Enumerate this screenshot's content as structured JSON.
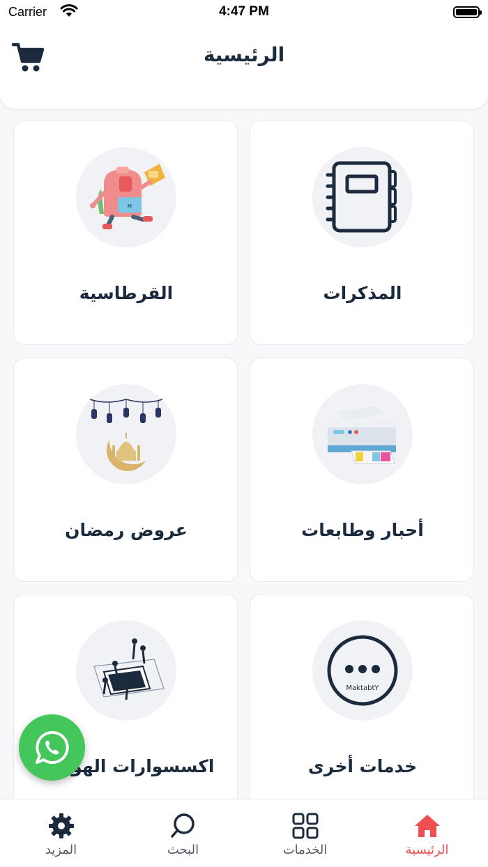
{
  "status_bar": {
    "carrier": "Carrier",
    "time": "4:47 PM"
  },
  "header": {
    "title": "الرئيسية",
    "cart_icon": "shopping-cart-icon"
  },
  "categories": [
    {
      "label": "المذكرات",
      "icon": "notebook-icon"
    },
    {
      "label": "القرطاسية",
      "icon": "school-backpack-illustration"
    },
    {
      "label": "أحبار وطابعات",
      "icon": "printer-illustration"
    },
    {
      "label": "عروض رمضان",
      "icon": "ramadan-lanterns-illustration"
    },
    {
      "label": "خدمات أخرى",
      "icon": "more-dots-icon"
    },
    {
      "label": "اكسسوارات الهواتف",
      "icon": "phone-accessories-illustration"
    }
  ],
  "other_services_logo": "MaktabtY",
  "whatsapp": {
    "icon": "whatsapp-icon",
    "color": "#45c65a"
  },
  "bottom_nav": [
    {
      "label": "الرئيسية",
      "icon": "home-icon",
      "active": true
    },
    {
      "label": "الخدمات",
      "icon": "grid-icon",
      "active": false
    },
    {
      "label": "البحث",
      "icon": "search-icon",
      "active": false
    },
    {
      "label": "المزيد",
      "icon": "gear-icon",
      "active": false
    }
  ],
  "colors": {
    "primary": "#1b2a3d",
    "active": "#ef4f4f",
    "background": "#f7f8fa"
  }
}
